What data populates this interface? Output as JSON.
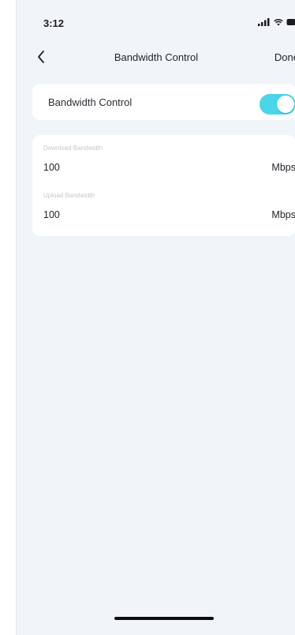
{
  "status_bar": {
    "time": "3:12",
    "icons": [
      "signal-icon",
      "wifi-icon",
      "battery-icon"
    ]
  },
  "nav": {
    "back_icon": "chevron-left-icon",
    "title": "Bandwidth Control",
    "done_label": "Done"
  },
  "toggle": {
    "label": "Bandwidth Control",
    "enabled": true,
    "accent_color": "#4ad5e8"
  },
  "bandwidth": {
    "download": {
      "label": "Download Bandwidth",
      "value": "100",
      "unit": "Mbps"
    },
    "upload": {
      "label": "Upload Bandwidth",
      "value": "100",
      "unit": "Mbps"
    }
  }
}
